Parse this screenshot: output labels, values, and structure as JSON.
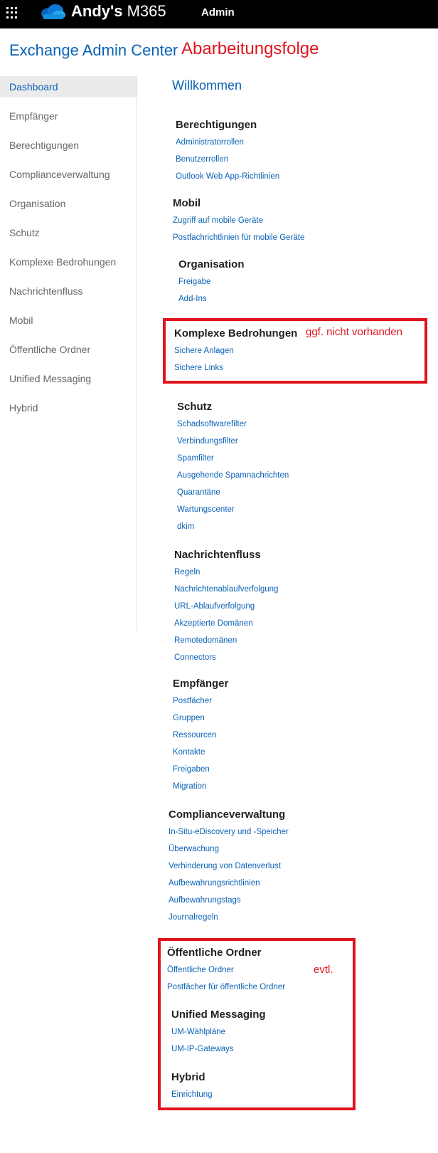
{
  "topbar": {
    "app_name_bold": "Andy's",
    "app_name_rest": " M365",
    "admin_label": "Admin",
    "launcher_icon": "waffle-icon",
    "logo_icon": "cloud-logo-icon"
  },
  "header": {
    "title": "Exchange Admin Center",
    "annotation": "Abarbeitungsfolge"
  },
  "sidebar": {
    "items": [
      {
        "label": "Dashboard",
        "active": true
      },
      {
        "label": "Empfänger"
      },
      {
        "label": "Berechtigungen"
      },
      {
        "label": "Complianceverwaltung"
      },
      {
        "label": "Organisation"
      },
      {
        "label": "Schutz"
      },
      {
        "label": "Komplexe Bedrohungen"
      },
      {
        "label": "Nachrichtenfluss"
      },
      {
        "label": "Mobil"
      },
      {
        "label": "Öffentliche Ordner"
      },
      {
        "label": "Unified Messaging"
      },
      {
        "label": "Hybrid"
      }
    ]
  },
  "main": {
    "welcome": "Willkommen",
    "sections": {
      "berechtigungen": {
        "title": "Berechtigungen",
        "links": [
          "Administratorrollen",
          "Benutzerrollen",
          "Outlook Web App-Richtlinien"
        ]
      },
      "mobil": {
        "title": "Mobil",
        "links": [
          "Zugriff auf mobile Geräte",
          "Postfachrichtlinien für mobile Geräte"
        ]
      },
      "organisation": {
        "title": "Organisation",
        "links": [
          "Freigabe",
          "Add-Ins"
        ]
      },
      "komplexe": {
        "title": "Komplexe Bedrohungen",
        "links": [
          "Sichere Anlagen",
          "Sichere Links"
        ]
      },
      "schutz": {
        "title": "Schutz",
        "links": [
          "Schadsoftwarefilter",
          "Verbindungsfilter",
          "Spamfilter",
          "Ausgehende Spamnachrichten",
          "Quarantäne",
          "Wartungscenter",
          "dkim"
        ]
      },
      "nachrichtenfluss": {
        "title": "Nachrichtenfluss",
        "links": [
          "Regeln",
          "Nachrichtenablaufverfolgung",
          "URL-Ablaufverfolgung",
          "Akzeptierte Domänen",
          "Remotedomänen",
          "Connectors"
        ]
      },
      "empfaenger": {
        "title": "Empfänger",
        "links": [
          "Postfächer",
          "Gruppen",
          "Ressourcen",
          "Kontakte",
          "Freigaben",
          "Migration"
        ]
      },
      "compliance": {
        "title": "Complianceverwaltung",
        "links": [
          "In-Situ-eDiscovery und -Speicher",
          "Überwachung",
          "Verhinderung von Datenverlust",
          "Aufbewahrungsrichtlinien",
          "Aufbewahrungstags",
          "Journalregeln"
        ]
      },
      "oeffentliche": {
        "title": "Öffentliche Ordner",
        "links": [
          "Öffentliche Ordner",
          "Postfächer für öffentliche Ordner"
        ]
      },
      "um": {
        "title": "Unified Messaging",
        "links": [
          "UM-Wählpläne",
          "UM-IP-Gateways"
        ]
      },
      "hybrid": {
        "title": "Hybrid",
        "links": [
          "Einrichtung"
        ]
      }
    }
  },
  "annotations": {
    "komplexe_note": "ggf. nicht vorhanden",
    "oeffentliche_note": "evtl.",
    "color": "#e0141e"
  },
  "colors": {
    "accent": "#0b63b6",
    "topbar": "#000000"
  }
}
